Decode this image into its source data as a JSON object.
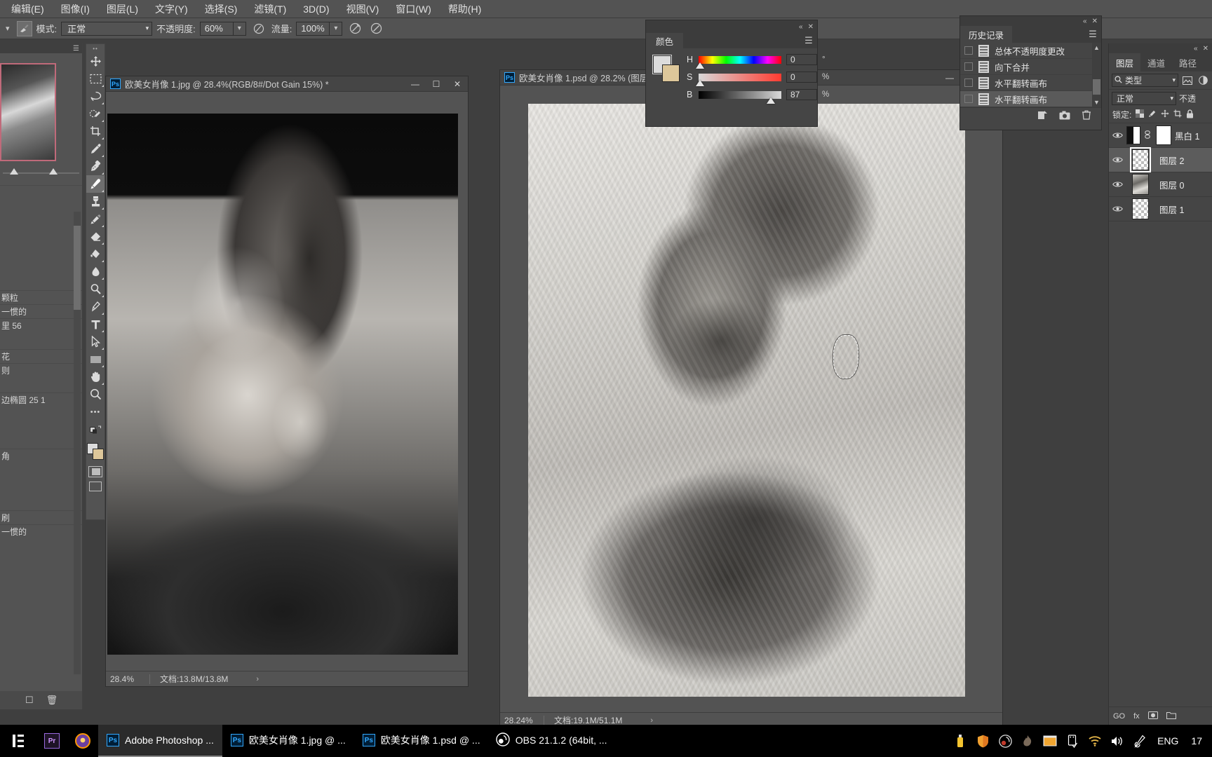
{
  "menubar": {
    "items": [
      {
        "label": "编辑(E)"
      },
      {
        "label": "图像(I)"
      },
      {
        "label": "图层(L)"
      },
      {
        "label": "文字(Y)"
      },
      {
        "label": "选择(S)"
      },
      {
        "label": "滤镜(T)"
      },
      {
        "label": "3D(D)"
      },
      {
        "label": "视图(V)"
      },
      {
        "label": "窗口(W)"
      },
      {
        "label": "帮助(H)"
      }
    ]
  },
  "optionsbar": {
    "mode_label": "模式:",
    "mode_value": "正常",
    "opacity_label": "不透明度:",
    "opacity_value": "60%",
    "flow_label": "流量:",
    "flow_value": "100%"
  },
  "toolbar": {
    "tools": [
      {
        "name": "move-tool",
        "title": "移动工具"
      },
      {
        "name": "marquee-tool",
        "title": "矩形选框工具"
      },
      {
        "name": "lasso-tool",
        "title": "套索工具"
      },
      {
        "name": "quick-selection-tool",
        "title": "快速选择工具"
      },
      {
        "name": "crop-tool",
        "title": "裁剪工具"
      },
      {
        "name": "eyedropper-tool",
        "title": "吸管工具"
      },
      {
        "name": "healing-brush-tool",
        "title": "修复画笔工具"
      },
      {
        "name": "brush-tool",
        "title": "画笔工具"
      },
      {
        "name": "clone-stamp-tool",
        "title": "仿制图章工具"
      },
      {
        "name": "history-brush-tool",
        "title": "历史记录画笔工具"
      },
      {
        "name": "eraser-tool",
        "title": "橡皮擦工具"
      },
      {
        "name": "gradient-tool",
        "title": "渐变工具"
      },
      {
        "name": "blur-tool",
        "title": "模糊工具"
      },
      {
        "name": "dodge-tool",
        "title": "减淡工具"
      },
      {
        "name": "pen-tool",
        "title": "钢笔工具"
      },
      {
        "name": "type-tool",
        "title": "横排文字工具"
      },
      {
        "name": "path-selection-tool",
        "title": "路径选择工具"
      },
      {
        "name": "rectangle-tool",
        "title": "矩形工具"
      },
      {
        "name": "hand-tool",
        "title": "抓手工具"
      },
      {
        "name": "zoom-tool",
        "title": "缩放工具"
      }
    ],
    "more_label": "•••",
    "active_tool": "brush-tool",
    "foreground_color": "#dcdcdc",
    "background_color": "#ddc79a"
  },
  "left_panel": {
    "rows": [
      {
        "label": "颗粒"
      },
      {
        "label": "一惯的"
      },
      {
        "label": "里 56"
      },
      {
        "label": "花"
      },
      {
        "label": "则"
      },
      {
        "label": "边椭圆 25 1"
      },
      {
        "label": "角"
      },
      {
        "label": "刷"
      },
      {
        "label": "一惯的"
      }
    ]
  },
  "documents": [
    {
      "name": "doc-window-jpg",
      "title": "欧美女肖像 1.jpg @ 28.4%(RGB/8#/Dot Gain 15%) *",
      "zoom": "28.4%",
      "doc_info": "文档:13.8M/13.8M",
      "arrow": "›",
      "minimize": "—",
      "maximize": "☐",
      "close": "✕"
    },
    {
      "name": "doc-window-psd",
      "title": "欧美女肖像 1.psd @ 28.2% (图层",
      "zoom": "28.24%",
      "doc_info": "文档:19.1M/51.1M",
      "arrow": "›",
      "minimize": "—",
      "maximize": "☐",
      "close": "✕"
    }
  ],
  "color_panel": {
    "tab_label": "颜色",
    "menu_icon": "hamburger-icon",
    "collapse_icon": "«",
    "close_icon": "✕",
    "channels": [
      {
        "name": "H",
        "value": "0",
        "unit": "°",
        "knob_pct": 2
      },
      {
        "name": "S",
        "value": "0",
        "unit": "%",
        "knob_pct": 2
      },
      {
        "name": "B",
        "value": "87",
        "unit": "%",
        "knob_pct": 87
      }
    ],
    "foreground_color": "#dcdcdc",
    "background_color": "#ddc79a"
  },
  "history_panel": {
    "tab_label": "历史记录",
    "menu_icon": "hamburger-icon",
    "collapse_icon": "«",
    "close_icon": "✕",
    "items": [
      {
        "label": "总体不透明度更改",
        "current": false
      },
      {
        "label": "向下合并",
        "current": false
      },
      {
        "label": "水平翻转画布",
        "current": false
      },
      {
        "label": "水平翻转画布",
        "current": true
      }
    ],
    "footer_buttons": [
      {
        "name": "new-document-from-state-button",
        "glyph": "❐"
      },
      {
        "name": "new-snapshot-button",
        "glyph": "▣"
      },
      {
        "name": "delete-state-button",
        "glyph": "Ὕ1"
      }
    ]
  },
  "layers_panel": {
    "tabs": [
      {
        "label": "图层",
        "active": true
      },
      {
        "label": "通道",
        "active": false
      },
      {
        "label": "路径",
        "active": false
      }
    ],
    "filter_label": "类型",
    "search_icon": "search-icon",
    "blend_mode": "正常",
    "opacity_label": "不透",
    "lock_label": "锁定:",
    "lock_icons": [
      "transparency-lock-icon",
      "brush-lock-icon",
      "move-lock-icon",
      "artboard-lock-icon",
      "all-lock-icon"
    ],
    "layers": [
      {
        "name": "黑白 1",
        "type": "adjustment",
        "visible": true,
        "selected": false,
        "linked": true
      },
      {
        "name": "图层 2",
        "type": "empty",
        "visible": true,
        "selected": true,
        "linked": false
      },
      {
        "name": "图层 0",
        "type": "image",
        "visible": true,
        "selected": false,
        "linked": false
      },
      {
        "name": "图层 1",
        "type": "empty",
        "visible": true,
        "selected": false,
        "linked": false
      }
    ],
    "bottom_icons": [
      "link-layers-icon",
      "fx-icon",
      "layer-mask-icon",
      "new-group-icon"
    ],
    "bottom_labels": [
      "GO",
      "fx"
    ]
  },
  "taskbar": {
    "start_icon": "windows-start-icon",
    "pinned": [
      {
        "name": "premiere-pro-icon",
        "label": "Pr"
      },
      {
        "name": "browser-icon",
        "label": ""
      }
    ],
    "apps": [
      {
        "name": "taskbar-photoshop",
        "label": "Adobe Photoshop ...",
        "icon": "ps-icon",
        "active": true
      },
      {
        "name": "taskbar-doc-jpg",
        "label": "欧美女肖像 1.jpg @ ...",
        "icon": "ps-icon",
        "active": false
      },
      {
        "name": "taskbar-doc-psd",
        "label": "欧美女肖像 1.psd @ ...",
        "icon": "ps-icon",
        "active": false
      },
      {
        "name": "taskbar-obs",
        "label": "OBS 21.1.2 (64bit, ...",
        "icon": "obs-icon",
        "active": false
      }
    ],
    "tray": [
      {
        "name": "usb-drive-icon",
        "glyph": "▮"
      },
      {
        "name": "shield-icon",
        "glyph": "⛨"
      },
      {
        "name": "obs-tray-icon",
        "glyph": "◎"
      },
      {
        "name": "flame-icon",
        "glyph": "✦"
      },
      {
        "name": "window-icon",
        "glyph": "▤"
      },
      {
        "name": "safely-remove-icon",
        "glyph": "▯"
      },
      {
        "name": "wifi-icon",
        "glyph": "◠"
      },
      {
        "name": "volume-icon",
        "glyph": "ὐa"
      },
      {
        "name": "pen-input-icon",
        "glyph": "✒"
      }
    ],
    "language": "ENG",
    "clock": "17"
  }
}
